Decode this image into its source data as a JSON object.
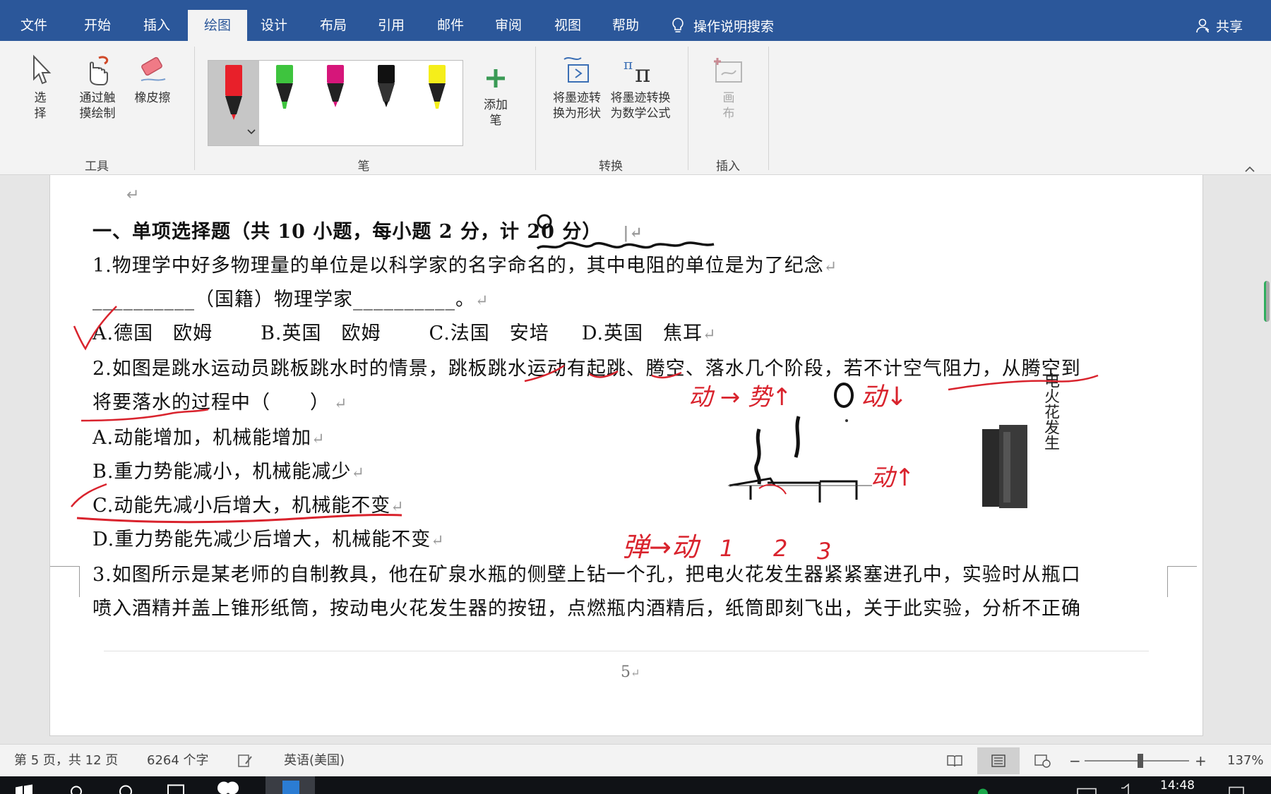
{
  "tabs": [
    {
      "label": "文件",
      "active": false
    },
    {
      "label": "开始",
      "active": false
    },
    {
      "label": "插入",
      "active": false
    },
    {
      "label": "绘图",
      "active": true
    },
    {
      "label": "设计",
      "active": false
    },
    {
      "label": "布局",
      "active": false
    },
    {
      "label": "引用",
      "active": false
    },
    {
      "label": "邮件",
      "active": false
    },
    {
      "label": "审阅",
      "active": false
    },
    {
      "label": "视图",
      "active": false
    },
    {
      "label": "帮助",
      "active": false
    }
  ],
  "tell_me": "操作说明搜索",
  "share_label": "共享",
  "ribbon": {
    "select_line1": "选",
    "select_line2": "择",
    "touch_draw_line1": "通过触",
    "touch_draw_line2": "摸绘制",
    "eraser": "橡皮擦",
    "tools_group": "工具",
    "pens_group": "笔",
    "add_pen_line1": "添加",
    "add_pen_line2": "笔",
    "ink_to_shape_line1": "将墨迹转",
    "ink_to_shape_line2": "换为形状",
    "ink_to_math_line1": "将墨迹转换",
    "ink_to_math_line2": "为数学公式",
    "convert_group": "转换",
    "canvas_line1": "画",
    "canvas_line2": "布",
    "insert_group": "插入",
    "pens": [
      {
        "name": "red-pen",
        "color": "#e8202a",
        "selected": true
      },
      {
        "name": "green-highlighter",
        "color": "#3ec43e"
      },
      {
        "name": "magenta-pen",
        "color": "#d6167a"
      },
      {
        "name": "black-pen",
        "color": "#111111"
      },
      {
        "name": "yellow-highlighter",
        "color": "#f5ee1a"
      }
    ]
  },
  "document": {
    "line0": "一、单项选择题（共 10 小题，每小题 2 分，计 20 分）",
    "line1": "1.物理学中好多物理量的单位是以科学家的名字命名的，其中电阻的单位是为了纪念",
    "line2": "__________（国籍）物理学家__________。",
    "line3_a": "A.德国　欧姆",
    "line3_b": "B.英国　欧姆",
    "line3_c": "C.法国　安培",
    "line3_d": "D.英国　焦耳",
    "line4": "2.如图是跳水运动员跳板跳水时的情景，跳板跳水运动有起跳、腾空、落水几个阶段，若不计空气阻力，从腾空到",
    "line5": "将要落水的过程中（　　）",
    "line6": "A.动能增加，机械能增加",
    "line7": "B.重力势能减小，机械能减少",
    "line8": "C.动能先减小后增大，机械能不变",
    "line9": "D.重力势能先减少后增大，机械能不变",
    "line10": "3.如图所示是某老师的自制教具，他在矿泉水瓶的侧壁上钻一个孔，把电火花发生器紧紧塞进孔中，实验时从瓶口",
    "line11": "喷入酒精并盖上锥形纸筒，按动电火花发生器的按钮，点燃瓶内酒精后，纸筒即刻飞出，关于此实验，分析不正确",
    "figure_label": "电火花发生",
    "page_number": "5",
    "ink_notes": [
      "动 → 势↑",
      "动↓",
      "动↑",
      "弹→动",
      "1",
      "2",
      "3"
    ]
  },
  "status": {
    "page_info": "第 5 页，共 12 页",
    "word_count": "6264 个字",
    "language": "英语(美国)",
    "zoom": "137%"
  },
  "taskbar": {
    "time": "14:48"
  },
  "colors": {
    "ribbon_blue": "#2b579a",
    "ink_red": "#d9232d",
    "ink_black": "#111111"
  }
}
